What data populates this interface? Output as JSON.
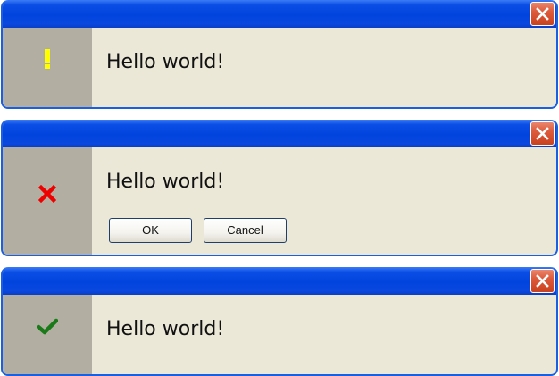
{
  "dialogs": [
    {
      "kind": "warning",
      "icon": "exclamation-icon",
      "message": "Hello world!"
    },
    {
      "kind": "error",
      "icon": "cross-icon",
      "message": "Hello world!",
      "buttons": {
        "ok_label": "OK",
        "cancel_label": "Cancel"
      }
    },
    {
      "kind": "success",
      "icon": "checkmark-icon",
      "message": "Hello world!"
    }
  ],
  "colors": {
    "titlebar": "#0044dd",
    "border": "#1a5fe0",
    "body_background": "#ebe8d8",
    "icon_panel": "#b2afa2",
    "close_button": "#dd5a3c",
    "warning_icon": "#ffff00",
    "error_icon": "#ee0000",
    "success_icon": "#1a7a1a"
  }
}
